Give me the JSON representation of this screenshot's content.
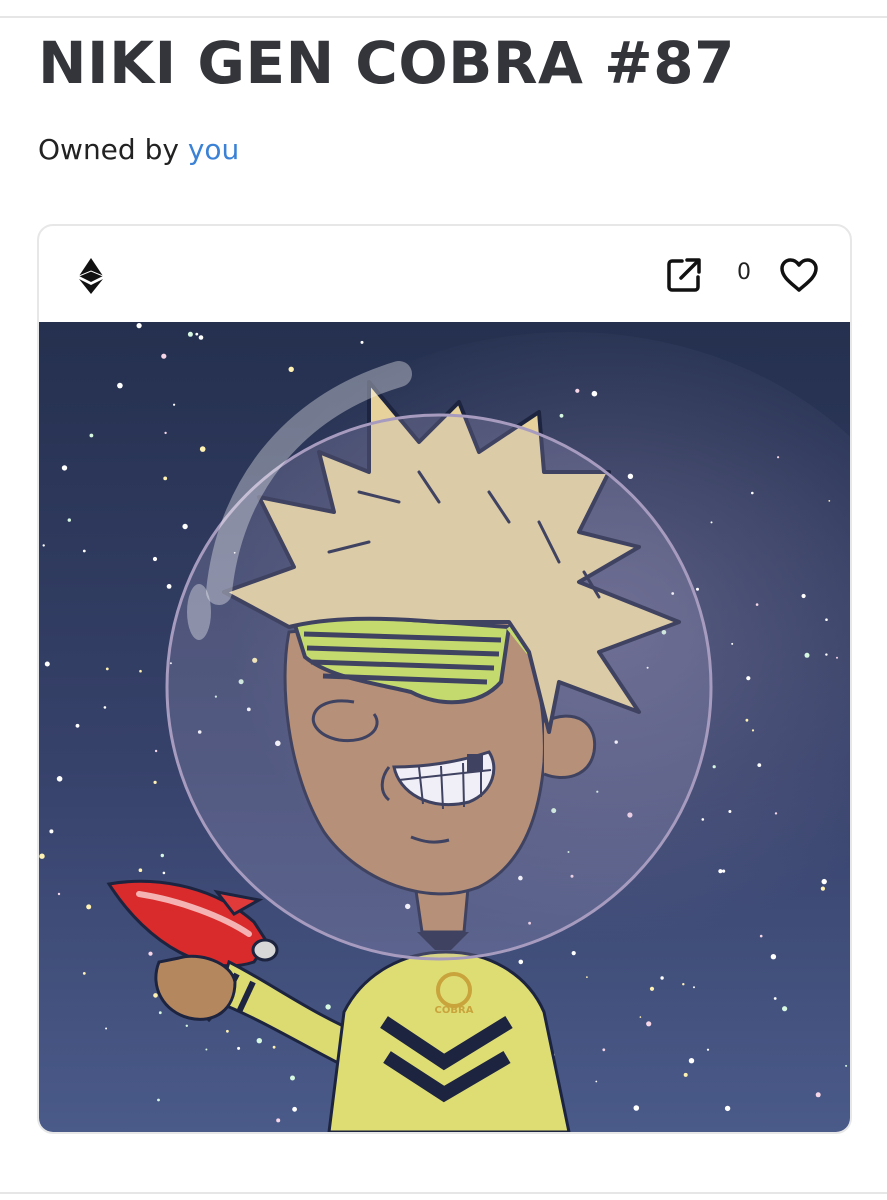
{
  "title": "NIKI GEN COBRA #87",
  "owner": {
    "prefix": "Owned by",
    "name": "you"
  },
  "card": {
    "chain_icon": "ethereum-icon",
    "link_icon": "external-link-icon",
    "like_count": "0",
    "like_icon": "heart-outline-icon",
    "image_alt": "NIKI GEN COBRA #87",
    "emblem_text": "COBRA"
  },
  "colors": {
    "accent_link": "#3b82d6",
    "text_dark": "#33353b",
    "border": "#e7e7e7",
    "space_top": "#26304f",
    "space_bottom": "#4a5a8a",
    "hair": "#e6d29a",
    "shirt": "#dedd74",
    "glasses": "#c8e651",
    "skin": "#b5875e",
    "raygun": "#d92b2b"
  }
}
